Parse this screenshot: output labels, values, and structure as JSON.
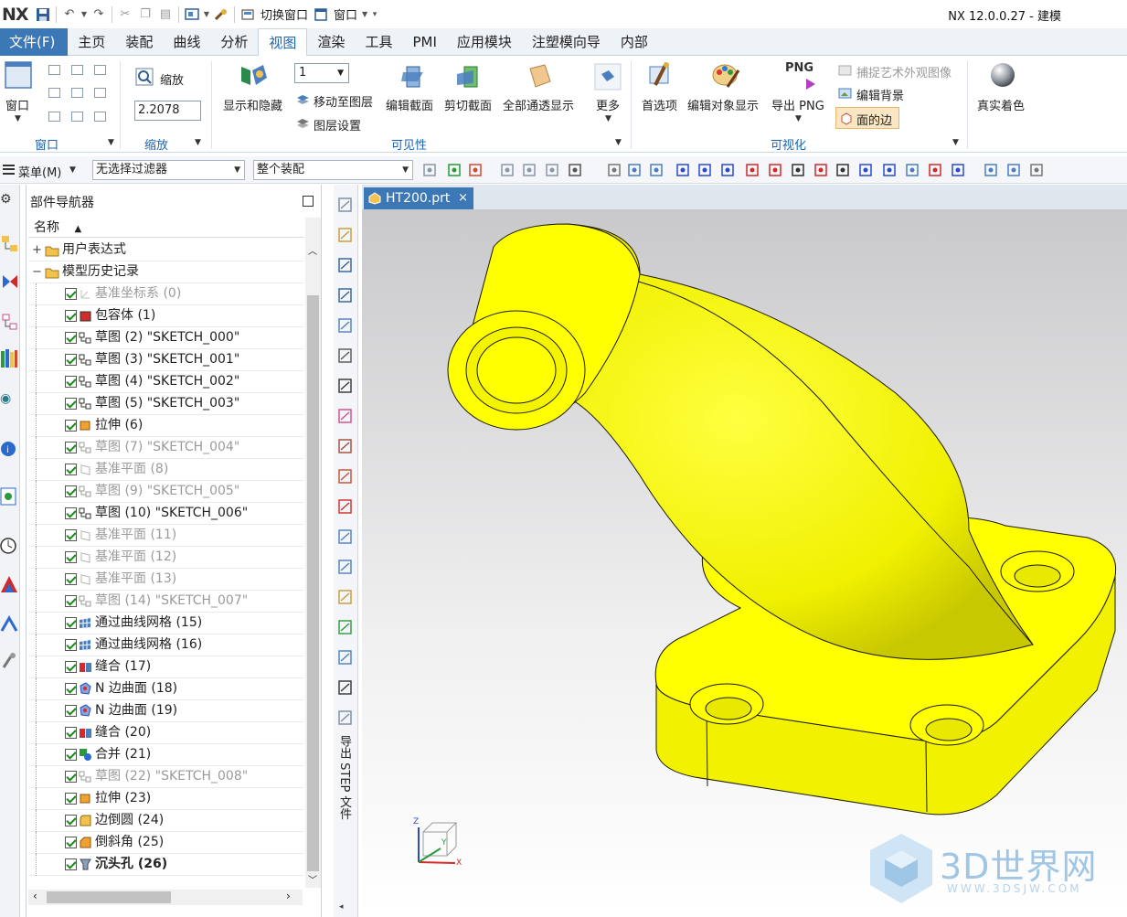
{
  "app": {
    "logo": "NX",
    "title": "NX 12.0.0.27 - 建模",
    "quick_access": {
      "switch_window": "切换窗口",
      "window": "窗口"
    }
  },
  "ribbon_tabs": [
    "文件(F)",
    "主页",
    "装配",
    "曲线",
    "分析",
    "视图",
    "渲染",
    "工具",
    "PMI",
    "应用模块",
    "注塑模向导",
    "内部"
  ],
  "active_tab": "视图",
  "ribbon": {
    "window_group": {
      "label": "窗口",
      "button": "窗口"
    },
    "zoom_group": {
      "label": "缩放",
      "button": "缩放",
      "value": "2.2078"
    },
    "visibility_group": {
      "label": "可见性",
      "layer_value": "1",
      "show_hide": "显示和隐藏",
      "move_to_layer": "移动至图层",
      "layer_settings": "图层设置",
      "edit_section": "编辑截面",
      "clip_section": "剪切截面",
      "all_through": "全部通透显示",
      "more": "更多"
    },
    "visualize_group": {
      "label": "可视化",
      "preferences": "首选项",
      "edit_object_display": "编辑对象显示",
      "export_png": "导出 PNG",
      "png_icon_text": "PNG",
      "capture_art": "捕捉艺术外观图像",
      "edit_background": "编辑背景",
      "face_edges": "面的边"
    },
    "true_shading": "真实着色"
  },
  "toolbar2": {
    "menu": "菜单(M)",
    "filter": "无选择过滤器",
    "scope": "整个装配"
  },
  "navigator": {
    "title": "部件导航器",
    "column": "名称",
    "rows": [
      {
        "text": "用户表达式",
        "level": 0,
        "type": "folder"
      },
      {
        "text": "模型历史记录",
        "level": 0,
        "type": "folder-open"
      },
      {
        "text": "基准坐标系 (0)",
        "level": 1,
        "dim": true,
        "icon": "csys"
      },
      {
        "text": "包容体 (1)",
        "level": 1,
        "icon": "body"
      },
      {
        "text": "草图 (2) \"SKETCH_000\"",
        "level": 1,
        "icon": "sketch"
      },
      {
        "text": "草图 (3) \"SKETCH_001\"",
        "level": 1,
        "icon": "sketch"
      },
      {
        "text": "草图 (4) \"SKETCH_002\"",
        "level": 1,
        "icon": "sketch"
      },
      {
        "text": "草图 (5) \"SKETCH_003\"",
        "level": 1,
        "icon": "sketch"
      },
      {
        "text": "拉伸 (6)",
        "level": 1,
        "icon": "extrude"
      },
      {
        "text": "草图 (7) \"SKETCH_004\"",
        "level": 1,
        "dim": true,
        "icon": "sketch"
      },
      {
        "text": "基准平面 (8)",
        "level": 1,
        "dim": true,
        "icon": "plane"
      },
      {
        "text": "草图 (9) \"SKETCH_005\"",
        "level": 1,
        "dim": true,
        "icon": "sketch"
      },
      {
        "text": "草图 (10) \"SKETCH_006\"",
        "level": 1,
        "icon": "sketch"
      },
      {
        "text": "基准平面 (11)",
        "level": 1,
        "dim": true,
        "icon": "plane"
      },
      {
        "text": "基准平面 (12)",
        "level": 1,
        "dim": true,
        "icon": "plane"
      },
      {
        "text": "基准平面 (13)",
        "level": 1,
        "dim": true,
        "icon": "plane"
      },
      {
        "text": "草图 (14) \"SKETCH_007\"",
        "level": 1,
        "dim": true,
        "icon": "sketch"
      },
      {
        "text": "通过曲线网格 (15)",
        "level": 1,
        "icon": "mesh"
      },
      {
        "text": "通过曲线网格 (16)",
        "level": 1,
        "icon": "mesh"
      },
      {
        "text": "缝合 (17)",
        "level": 1,
        "icon": "sew"
      },
      {
        "text": "N 边曲面 (18)",
        "level": 1,
        "icon": "nsided"
      },
      {
        "text": "N 边曲面 (19)",
        "level": 1,
        "icon": "nsided"
      },
      {
        "text": "缝合 (20)",
        "level": 1,
        "icon": "sew"
      },
      {
        "text": "合并 (21)",
        "level": 1,
        "icon": "unite"
      },
      {
        "text": "草图 (22) \"SKETCH_008\"",
        "level": 1,
        "dim": true,
        "icon": "sketch"
      },
      {
        "text": "拉伸 (23)",
        "level": 1,
        "icon": "extrude"
      },
      {
        "text": "边倒圆 (24)",
        "level": 1,
        "icon": "blend"
      },
      {
        "text": "倒斜角 (25)",
        "level": 1,
        "icon": "chamfer"
      },
      {
        "text": "沉头孔 (26)",
        "level": 1,
        "bold": true,
        "icon": "hole"
      }
    ]
  },
  "resource_bar_label": "导出 STEP 文件",
  "document_tab": {
    "name": "HT200.prt",
    "close": "×"
  },
  "triad": {
    "x": "X",
    "y": "Y",
    "z": "Z"
  },
  "watermark": {
    "text": "3D世界网",
    "url": "WWW.3DSJW.COM"
  },
  "colors": {
    "accent": "#3b78b5",
    "part": "#ffff00",
    "edge": "#1a1a00",
    "check": "#1b8a1b"
  }
}
